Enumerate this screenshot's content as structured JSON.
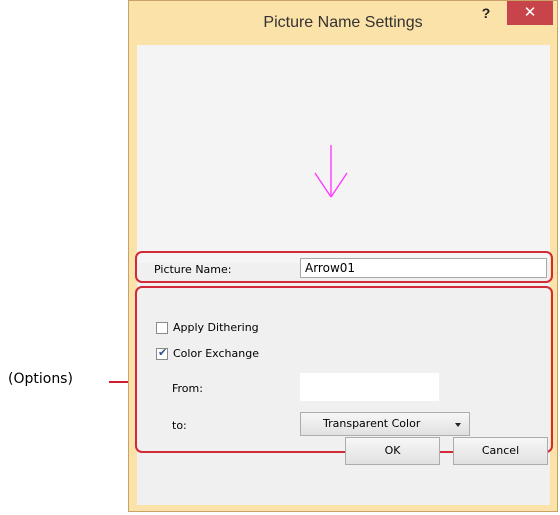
{
  "callout": {
    "label": "(Options)"
  },
  "dialog": {
    "title": "Picture Name Settings",
    "help_glyph": "?",
    "close_glyph": "✕"
  },
  "preview": {
    "icon": "down-arrow-icon",
    "arrow_color": "#ff3cff"
  },
  "picture_name": {
    "label": "Picture Name:",
    "value": "Arrow01"
  },
  "options": {
    "apply_dithering": {
      "label": "Apply Dithering",
      "checked": false
    },
    "color_exchange": {
      "label": "Color Exchange",
      "checked": true
    },
    "from_label": "From:",
    "from_value": "",
    "to_label": "to:",
    "to_value": "Transparent Color"
  },
  "buttons": {
    "ok": "OK",
    "cancel": "Cancel"
  },
  "colors": {
    "highlight": "#d22a37",
    "frame": "#fbe2a8",
    "close": "#c7454a"
  }
}
